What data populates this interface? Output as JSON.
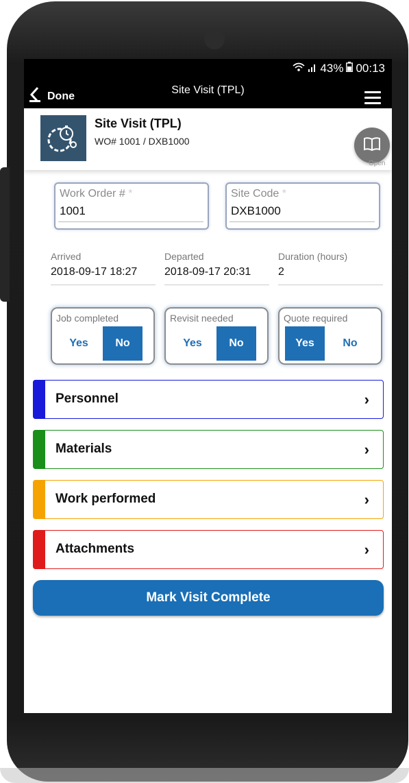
{
  "status_bar": {
    "battery": "43%",
    "time": "00:13"
  },
  "app_bar": {
    "back_label": "Done",
    "title": "Site Visit (TPL)"
  },
  "header": {
    "title": "Site Visit (TPL)",
    "subtitle": "WO# 1001 / DXB1000",
    "open_label": "Open"
  },
  "fields": {
    "work_order": {
      "label": "Work Order #",
      "required_mark": "*",
      "value": "1001"
    },
    "site_code": {
      "label": "Site Code",
      "required_mark": "*",
      "value": "DXB1000"
    },
    "arrived": {
      "label": "Arrived",
      "value": "2018-09-17 18:27"
    },
    "departed": {
      "label": "Departed",
      "value": "2018-09-17 20:31"
    },
    "duration": {
      "label": "Duration (hours)",
      "value": "2"
    }
  },
  "toggles": [
    {
      "label": "Job completed",
      "yes": "Yes",
      "no": "No",
      "selected": "No"
    },
    {
      "label": "Revisit needed",
      "yes": "Yes",
      "no": "No",
      "selected": "No"
    },
    {
      "label": "Quote required",
      "yes": "Yes",
      "no": "No",
      "selected": "Yes"
    }
  ],
  "sections": [
    {
      "title": "Personnel",
      "color": "#1a1adb"
    },
    {
      "title": "Materials",
      "color": "#1a8f1a"
    },
    {
      "title": "Work performed",
      "color": "#f5a300"
    },
    {
      "title": "Attachments",
      "color": "#e01b1b"
    }
  ],
  "complete_button": "Mark Visit Complete",
  "colors": {
    "accent": "#1f6fb5",
    "header_bar": "#000000",
    "logo_bg": "#34546e"
  }
}
